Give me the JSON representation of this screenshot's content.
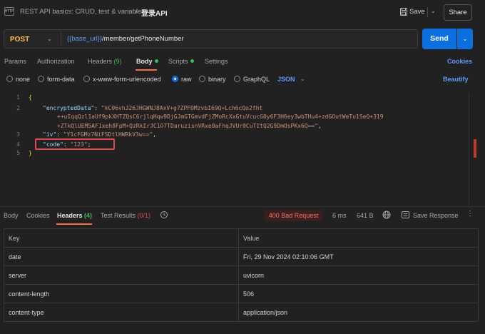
{
  "header": {
    "badge": "HTTP",
    "breadcrumb_parent": "REST API basics: CRUD, test & variable",
    "breadcrumb_sep": "/",
    "breadcrumb_current": "登录API",
    "save_label": "Save",
    "share_label": "Share"
  },
  "request": {
    "method": "POST",
    "url_variable": "{{base_url}}",
    "url_path": "/member/getPhoneNumber",
    "send_label": "Send"
  },
  "request_tabs": {
    "params": "Params",
    "authorization": "Authorization",
    "headers": "Headers",
    "headers_count": "(9)",
    "body": "Body",
    "scripts": "Scripts",
    "settings": "Settings",
    "cookies": "Cookies",
    "active": "Body"
  },
  "body_types": {
    "none": "none",
    "form_data": "form-data",
    "urlencoded": "x-www-form-urlencoded",
    "raw": "raw",
    "binary": "binary",
    "graphql": "GraphQL",
    "selected": "raw",
    "format": "JSON",
    "beautify": "Beautify"
  },
  "editor": {
    "line_numbers": [
      "1",
      "2",
      "3",
      "4",
      "5"
    ],
    "line1": "{",
    "line2_key": "\"encryptedData\"",
    "line2_value_a": "\"kC06vhJ26JHGWNJ8AxV+g7ZPFDMzvbI69Q+Lch6cQo2fht",
    "line2_value_b": "++uIqqQzl1aUf9pkXHTZQsC6rjlqHqw9DjGJmGTGmvdFjZMoRcXxGtuVcucG0y6F3H6ey3wbTHu4+zdGOutWeTu1SeQ+319",
    "line2_value_c": "+ZTkQlUEM5AF1xeh8FpM+QzRkIrJC1O7TDaruzisnVRxe0aFhqJVUr0CuTItQ2G9DmOsPKx6Q==\"",
    "line3_key": "\"iv\"",
    "line3_value": "\"Y1cFGMz7NiFSDtlHWRkV3w==\"",
    "line4_key": "\"code\"",
    "line4_value": "\"123\"",
    "line5": "}"
  },
  "response": {
    "tabs": {
      "body": "Body",
      "cookies": "Cookies",
      "headers": "Headers",
      "headers_count": "(4)",
      "test_results": "Test Results",
      "test_count": "(0/1)",
      "active": "Headers"
    },
    "status": "400 Bad Request",
    "time": "6 ms",
    "size": "641 B",
    "save_response": "Save Response",
    "table": {
      "columns": [
        "Key",
        "Value"
      ],
      "rows": [
        [
          "date",
          "Fri, 29 Nov 2024 02:10:06 GMT"
        ],
        [
          "server",
          "uvicorn"
        ],
        [
          "content-length",
          "506"
        ],
        [
          "content-type",
          "application/json"
        ]
      ]
    }
  },
  "colors": {
    "accent_orange": "#ff6c37",
    "send_blue": "#0b6fe0",
    "method_yellow": "#ffc24b",
    "error_red": "#e5484d",
    "ok_green": "#3fb950"
  }
}
